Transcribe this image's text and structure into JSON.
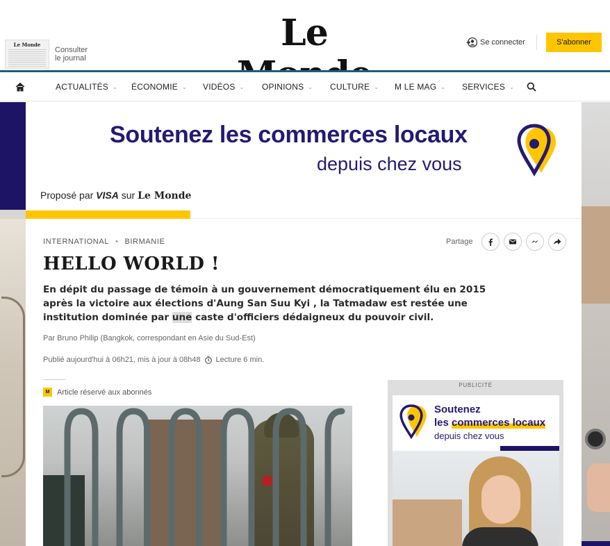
{
  "header": {
    "logo": "Le Monde",
    "journal_thumb_title": "Le Monde",
    "journal_link_line1": "Consulter",
    "journal_link_line2": "le journal",
    "login_label": "Se connecter",
    "subscribe_label": "S'abonner"
  },
  "nav": {
    "items": [
      {
        "label": "ACTUALITÉS"
      },
      {
        "label": "ÉCONOMIE"
      },
      {
        "label": "VIDÉOS"
      },
      {
        "label": "OPINIONS"
      },
      {
        "label": "CULTURE"
      },
      {
        "label": "M LE MAG"
      },
      {
        "label": "SERVICES"
      }
    ]
  },
  "banner_ad": {
    "line1_prefix": "Soutenez les ",
    "line1_highlight": "commerces locaux",
    "line2": "depuis chez vous",
    "proposed_prefix": "Proposé par ",
    "proposed_brand": "VISA",
    "proposed_mid": " sur ",
    "proposed_site": "Le Monde"
  },
  "article": {
    "section": "INTERNATIONAL",
    "subsection": "BIRMANIE",
    "share_label": "Partage",
    "title": "HELLO WORLD !",
    "desc_before": "En dépit du passage de témoin à un gouvernement démocratiquement élu en 2015 après la victoire aux élections d'Aung San Suu Kyi , la Tatmadaw est restée une institution dominée par ",
    "desc_mark": "une",
    "desc_after": " caste d'officiers dédaigneux du pouvoir civil.",
    "author": "Par Bruno Philip (Bangkok, correspondant en Asie du Sud-Est)",
    "published": "Publié aujourd'hui à 06h21, mis à jour à 08h48",
    "read_time": "Lecture 6 min.",
    "reserved_badge": "M",
    "reserved_label": "Article réservé aux abonnés"
  },
  "sidebar_ad": {
    "label": "PUBLICITÉ",
    "line1": "Soutenez",
    "line2_prefix": "les ",
    "line2_highlight": "commerces locaux",
    "line3": "depuis chez vous"
  },
  "colors": {
    "brand_yellow": "#ffc600",
    "ad_navy": "#241a73",
    "header_rule": "#1a5f7a"
  }
}
